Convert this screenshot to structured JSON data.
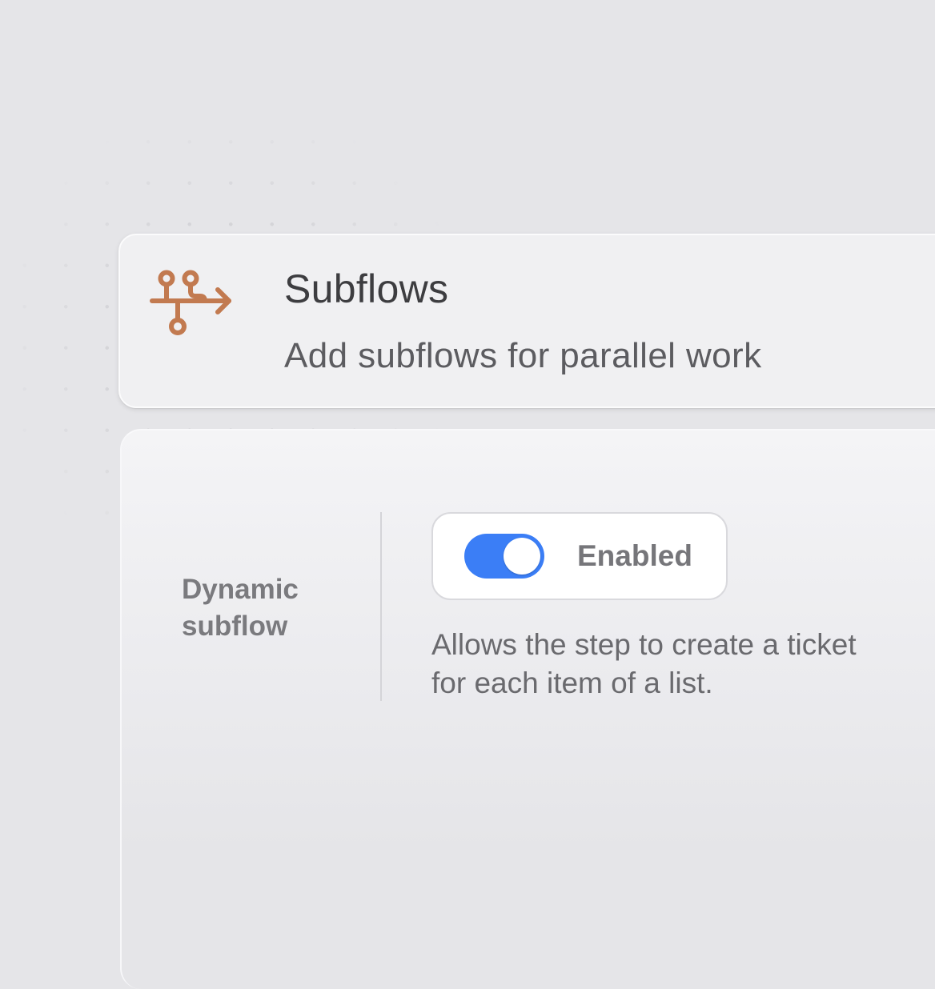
{
  "header": {
    "icon": "subflow-branch-arrow-icon",
    "title": "Subflows",
    "subtitle": "Add subflows for parallel work"
  },
  "setting": {
    "label": "Dynamic subflow",
    "toggle": {
      "state_label": "Enabled",
      "on": true
    },
    "description": "Allows the step to create a ticket for each item of a list."
  },
  "colors": {
    "background": "#e5e5e8",
    "icon_accent": "#c27a50",
    "toggle_on": "#3b7ef6"
  }
}
